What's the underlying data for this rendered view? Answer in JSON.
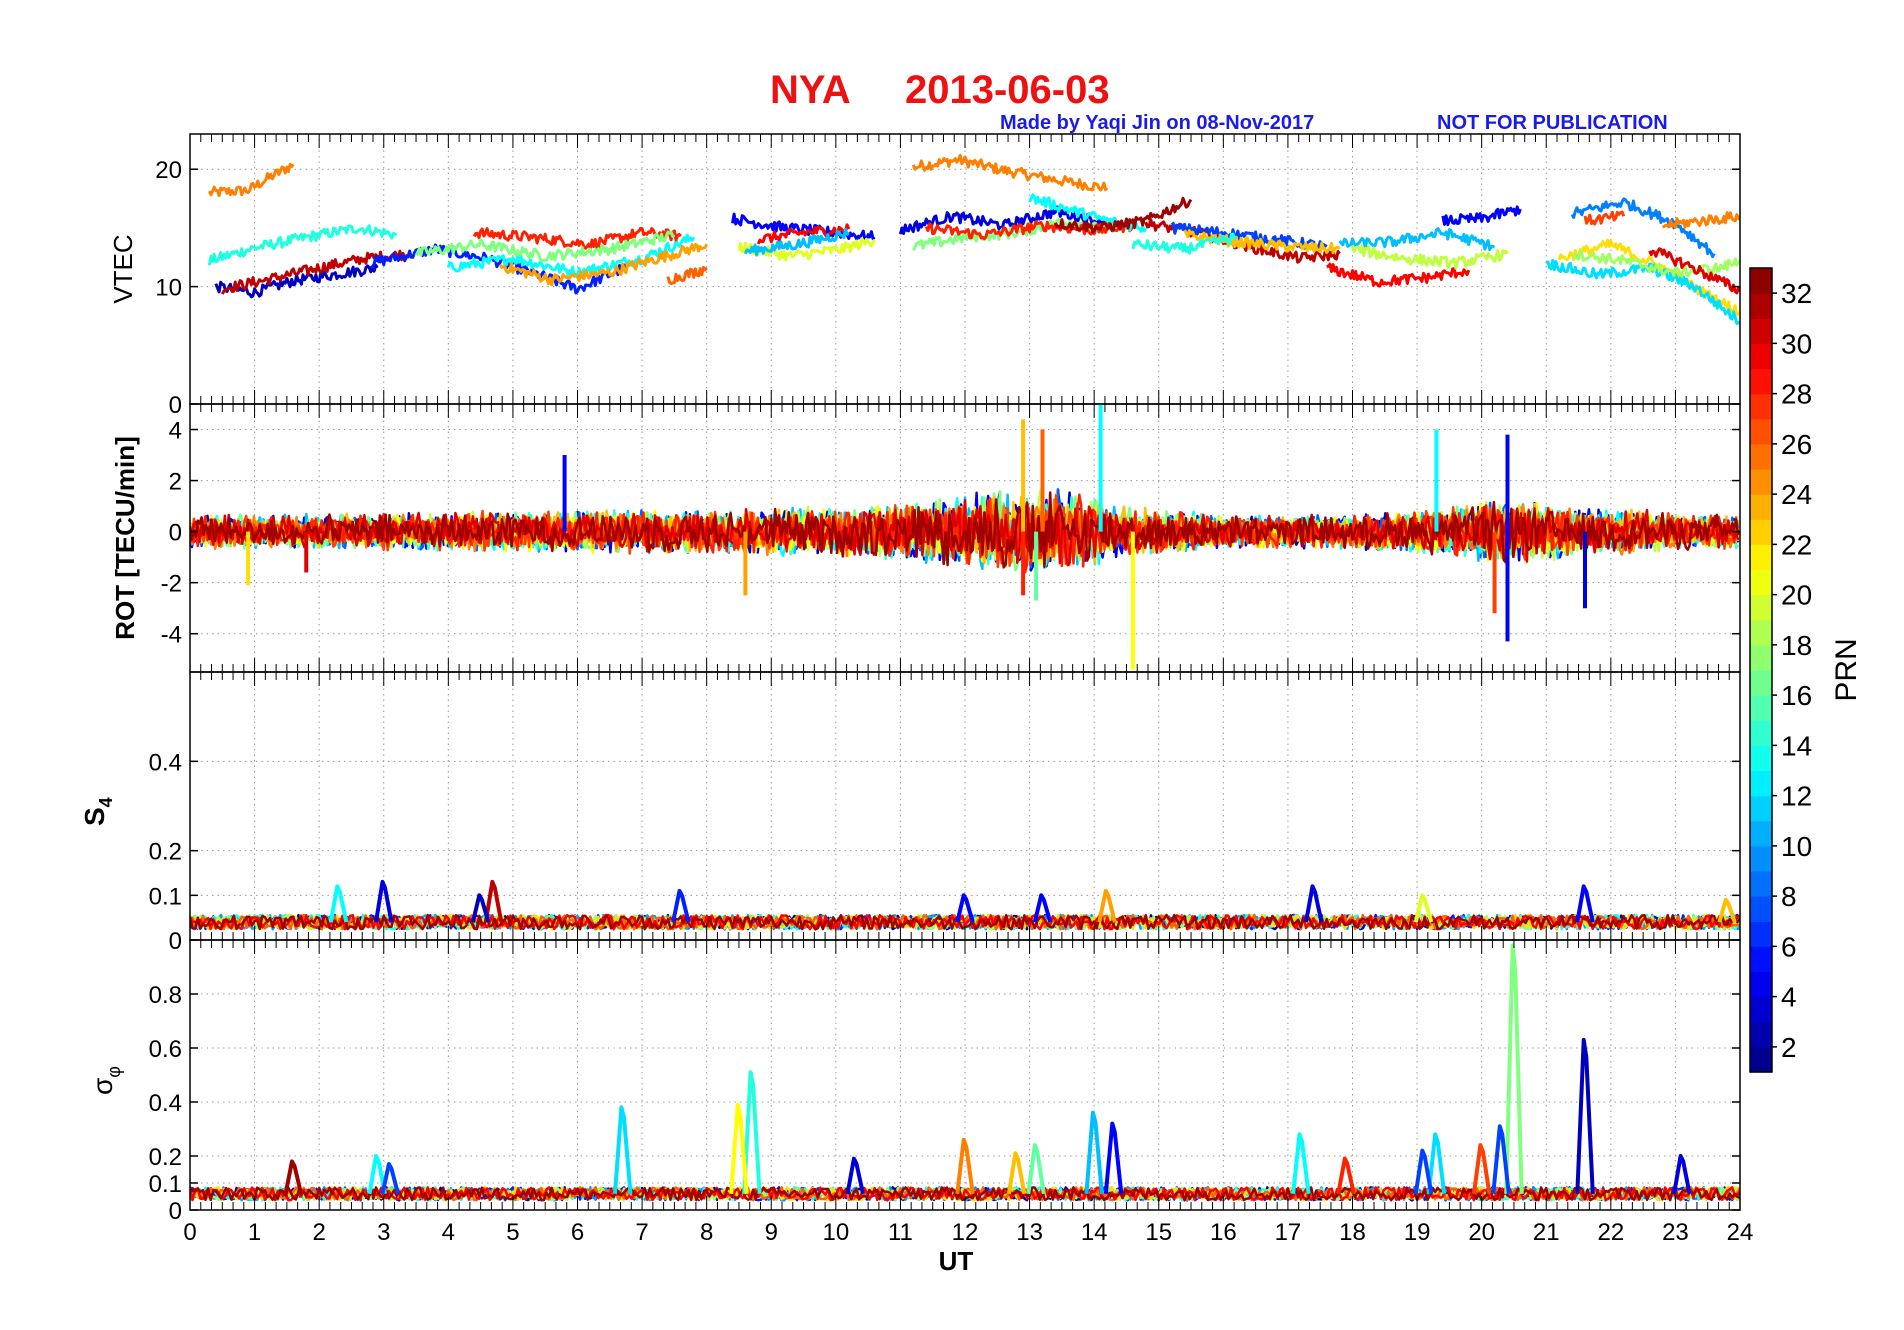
{
  "figure": {
    "station": "NYA",
    "date": "2013-06-03",
    "credit": "Made by Yaqi Jin on 08-Nov-2017",
    "notice": "NOT FOR PUBLICATION"
  },
  "chart_data": [
    {
      "type": "line",
      "panel": "vtec",
      "ylabel": "VTEC",
      "ylim": [
        0,
        23
      ],
      "yticks": [
        "0",
        "10",
        "20"
      ],
      "grid": true,
      "series": [
        {
          "prn": 25,
          "x": [
            0.3,
            0.9,
            1.2,
            1.6
          ],
          "y": [
            18.0,
            18.2,
            19.2,
            20.4
          ]
        },
        {
          "prn": 25,
          "x": [
            11.2,
            11.9,
            12.6,
            13.5,
            14.2
          ],
          "y": [
            20.2,
            20.8,
            19.9,
            19.0,
            18.4
          ]
        },
        {
          "prn": 14,
          "x": [
            0.3,
            1.0,
            1.8,
            2.6,
            3.2
          ],
          "y": [
            12.2,
            13.3,
            14.2,
            15.0,
            14.4
          ]
        },
        {
          "prn": 3,
          "x": [
            0.4,
            1.0,
            1.6,
            2.2,
            2.9
          ],
          "y": [
            10.0,
            9.5,
            10.5,
            11.0,
            11.6
          ]
        },
        {
          "prn": 31,
          "x": [
            0.5,
            1.2,
            2.0,
            2.7,
            3.4
          ],
          "y": [
            9.8,
            10.6,
            11.6,
            12.4,
            12.8
          ]
        },
        {
          "prn": 6,
          "x": [
            2.8,
            3.8,
            4.6,
            5.4,
            6.0,
            6.8
          ],
          "y": [
            12.0,
            13.2,
            12.4,
            11.0,
            9.8,
            11.8
          ]
        },
        {
          "prn": 13,
          "x": [
            4.0,
            5.0,
            6.0,
            7.0,
            7.8
          ],
          "y": [
            11.6,
            12.4,
            11.2,
            12.4,
            14.2
          ]
        },
        {
          "prn": 28,
          "x": [
            4.4,
            5.3,
            6.2,
            7.0,
            7.6
          ],
          "y": [
            14.6,
            14.2,
            13.6,
            14.6,
            14.3
          ]
        },
        {
          "prn": 24,
          "x": [
            4.8,
            5.6,
            6.5,
            7.3,
            8.0
          ],
          "y": [
            11.8,
            10.6,
            11.2,
            12.5,
            13.6
          ]
        },
        {
          "prn": 17,
          "x": [
            3.5,
            4.5,
            5.5,
            6.5,
            7.5
          ],
          "y": [
            12.8,
            13.6,
            12.6,
            13.2,
            14.4
          ]
        },
        {
          "prn": 26,
          "x": [
            7.4,
            7.8,
            8.0
          ],
          "y": [
            10.6,
            11.2,
            11.6
          ]
        },
        {
          "prn": 5,
          "x": [
            8.4,
            9.2,
            10.0,
            10.6
          ],
          "y": [
            15.8,
            15.0,
            14.6,
            14.2
          ]
        },
        {
          "prn": 20,
          "x": [
            8.5,
            9.3,
            10.1,
            10.6
          ],
          "y": [
            13.4,
            12.6,
            13.2,
            14.0
          ]
        },
        {
          "prn": 29,
          "x": [
            8.8,
            9.5,
            10.2
          ],
          "y": [
            14.0,
            14.6,
            14.9
          ]
        },
        {
          "prn": 11,
          "x": [
            8.6,
            9.4,
            10.2
          ],
          "y": [
            13.0,
            13.6,
            14.6
          ]
        },
        {
          "prn": 4,
          "x": [
            11.0,
            11.8,
            12.6,
            13.4,
            14.2
          ],
          "y": [
            14.8,
            16.0,
            15.2,
            16.4,
            15.4
          ]
        },
        {
          "prn": 17,
          "x": [
            11.2,
            12.0,
            12.8,
            13.6,
            14.3
          ],
          "y": [
            13.4,
            14.2,
            14.6,
            15.6,
            14.6
          ]
        },
        {
          "prn": 28,
          "x": [
            11.4,
            12.3,
            13.2,
            14.0,
            14.6
          ],
          "y": [
            15.0,
            14.4,
            15.2,
            14.8,
            15.2
          ]
        },
        {
          "prn": 13,
          "x": [
            13.0,
            13.6,
            14.2,
            14.8
          ],
          "y": [
            17.6,
            16.6,
            15.6,
            15.0
          ]
        },
        {
          "prn": 32,
          "x": [
            13.4,
            14.1,
            14.8,
            15.5
          ],
          "y": [
            15.4,
            15.0,
            15.6,
            17.4
          ]
        },
        {
          "prn": 31,
          "x": [
            14.8,
            15.6,
            16.4,
            17.2,
            17.8
          ],
          "y": [
            15.4,
            14.6,
            13.4,
            12.4,
            12.8
          ]
        },
        {
          "prn": 7,
          "x": [
            15.2,
            16.0,
            16.8,
            17.6
          ],
          "y": [
            15.0,
            14.6,
            14.0,
            13.4
          ]
        },
        {
          "prn": 23,
          "x": [
            15.4,
            16.2,
            17.0,
            17.8
          ],
          "y": [
            14.4,
            13.8,
            13.4,
            13.2
          ]
        },
        {
          "prn": 14,
          "x": [
            14.6,
            15.4,
            16.2
          ],
          "y": [
            13.6,
            13.2,
            14.2
          ]
        },
        {
          "prn": 29,
          "x": [
            17.6,
            18.4,
            19.2,
            19.8
          ],
          "y": [
            11.6,
            10.4,
            10.8,
            11.4
          ]
        },
        {
          "prn": 11,
          "x": [
            17.8,
            18.6,
            19.4,
            20.2
          ],
          "y": [
            13.6,
            13.8,
            14.6,
            13.4
          ]
        },
        {
          "prn": 19,
          "x": [
            18.0,
            18.8,
            19.6,
            20.4
          ],
          "y": [
            13.2,
            12.4,
            12.0,
            12.8
          ]
        },
        {
          "prn": 5,
          "x": [
            19.4,
            20.0,
            20.6
          ],
          "y": [
            15.6,
            15.8,
            16.6
          ]
        },
        {
          "prn": 9,
          "x": [
            21.4,
            22.2,
            23.0,
            23.6
          ],
          "y": [
            16.2,
            17.2,
            15.4,
            12.8
          ]
        },
        {
          "prn": 27,
          "x": [
            21.6,
            22.2
          ],
          "y": [
            15.6,
            16.0
          ]
        },
        {
          "prn": 25,
          "x": [
            22.8,
            23.4,
            24.0
          ],
          "y": [
            15.2,
            15.6,
            16.0
          ]
        },
        {
          "prn": 22,
          "x": [
            21.2,
            22.0,
            22.8,
            23.4,
            24.0
          ],
          "y": [
            12.4,
            13.6,
            11.6,
            9.6,
            7.8
          ]
        },
        {
          "prn": 12,
          "x": [
            21.0,
            21.8,
            22.6,
            23.3,
            24.0
          ],
          "y": [
            12.0,
            11.0,
            11.6,
            10.0,
            7.0
          ]
        },
        {
          "prn": 18,
          "x": [
            21.4,
            22.2,
            23.0,
            23.7,
            24.0
          ],
          "y": [
            12.8,
            12.2,
            11.2,
            11.6,
            12.2
          ]
        },
        {
          "prn": 30,
          "x": [
            22.6,
            23.2,
            23.8,
            24.0
          ],
          "y": [
            13.2,
            11.8,
            10.2,
            9.6
          ]
        }
      ]
    },
    {
      "type": "line",
      "panel": "rot",
      "ylabel": "ROT [TECU/min]",
      "ylim": [
        -5.5,
        5
      ],
      "yticks": [
        "-4",
        "-2",
        "0",
        "2",
        "4"
      ],
      "grid": true,
      "spikes": [
        {
          "prn": 5,
          "x": 5.8,
          "y": 3.0
        },
        {
          "prn": 5,
          "x": 20.4,
          "y": 3.8
        },
        {
          "prn": 5,
          "x": 20.4,
          "y": -4.3
        },
        {
          "prn": 13,
          "x": 14.1,
          "y": 5.0
        },
        {
          "prn": 23,
          "x": 12.9,
          "y": 4.4
        },
        {
          "prn": 26,
          "x": 13.2,
          "y": 4.0
        },
        {
          "prn": 21,
          "x": 14.6,
          "y": -5.4
        },
        {
          "prn": 4,
          "x": 21.6,
          "y": -3.0
        },
        {
          "prn": 13,
          "x": 19.3,
          "y": 4.0
        },
        {
          "prn": 28,
          "x": 12.9,
          "y": -2.5
        },
        {
          "prn": 24,
          "x": 8.6,
          "y": -2.5
        },
        {
          "prn": 27,
          "x": 20.2,
          "y": -3.2
        },
        {
          "prn": 16,
          "x": 13.1,
          "y": -2.7
        },
        {
          "prn": 22,
          "x": 0.9,
          "y": -2.1
        },
        {
          "prn": 30,
          "x": 1.8,
          "y": -1.6
        }
      ],
      "noise_envelope": {
        "x": [
          0,
          2,
          4,
          6,
          8,
          10,
          11.5,
          12.5,
          13.5,
          14.5,
          16,
          18,
          19.5,
          20.5,
          21.5,
          23,
          24
        ],
        "amplitude": [
          0.7,
          0.7,
          0.8,
          0.9,
          0.9,
          1.0,
          1.3,
          1.8,
          1.7,
          1.0,
          0.7,
          0.7,
          1.0,
          1.4,
          1.0,
          0.8,
          0.7
        ]
      }
    },
    {
      "type": "line",
      "panel": "s4",
      "ylabel": "S4",
      "ylim": [
        0,
        0.6
      ],
      "yticks": [
        "0",
        "0.1",
        "0.2",
        "0.4"
      ],
      "grid": true,
      "baseline": 0.04,
      "peaks": [
        {
          "prn": 4,
          "x": 3.0,
          "y": 0.13
        },
        {
          "prn": 31,
          "x": 4.7,
          "y": 0.13
        },
        {
          "prn": 3,
          "x": 4.5,
          "y": 0.1
        },
        {
          "prn": 6,
          "x": 7.6,
          "y": 0.11
        },
        {
          "prn": 5,
          "x": 12.0,
          "y": 0.1
        },
        {
          "prn": 5,
          "x": 13.2,
          "y": 0.1
        },
        {
          "prn": 24,
          "x": 14.2,
          "y": 0.11
        },
        {
          "prn": 4,
          "x": 17.4,
          "y": 0.12
        },
        {
          "prn": 20,
          "x": 19.1,
          "y": 0.1
        },
        {
          "prn": 5,
          "x": 21.6,
          "y": 0.12
        },
        {
          "prn": 13,
          "x": 2.3,
          "y": 0.12
        },
        {
          "prn": 23,
          "x": 23.8,
          "y": 0.09
        }
      ]
    },
    {
      "type": "line",
      "panel": "sigma_phi",
      "ylabel": "σφ",
      "ylim": [
        0,
        1
      ],
      "yticks": [
        "0",
        "0.1",
        "0.2",
        "0.4",
        "0.6",
        "0.8"
      ],
      "grid": true,
      "baseline": 0.06,
      "peaks": [
        {
          "prn": 17,
          "x": 20.5,
          "y": 0.98
        },
        {
          "prn": 3,
          "x": 21.6,
          "y": 0.63
        },
        {
          "prn": 14,
          "x": 8.7,
          "y": 0.51
        },
        {
          "prn": 12,
          "x": 6.7,
          "y": 0.38
        },
        {
          "prn": 21,
          "x": 8.5,
          "y": 0.39
        },
        {
          "prn": 11,
          "x": 14.0,
          "y": 0.36
        },
        {
          "prn": 5,
          "x": 14.3,
          "y": 0.32
        },
        {
          "prn": 7,
          "x": 20.3,
          "y": 0.31
        },
        {
          "prn": 13,
          "x": 17.2,
          "y": 0.28
        },
        {
          "prn": 12,
          "x": 19.3,
          "y": 0.28
        },
        {
          "prn": 25,
          "x": 12.0,
          "y": 0.26
        },
        {
          "prn": 27,
          "x": 20.0,
          "y": 0.24
        },
        {
          "prn": 7,
          "x": 19.1,
          "y": 0.22
        },
        {
          "prn": 16,
          "x": 13.1,
          "y": 0.24
        },
        {
          "prn": 4,
          "x": 23.1,
          "y": 0.2
        },
        {
          "prn": 28,
          "x": 17.9,
          "y": 0.19
        },
        {
          "prn": 4,
          "x": 10.3,
          "y": 0.19
        },
        {
          "prn": 32,
          "x": 1.6,
          "y": 0.18
        },
        {
          "prn": 13,
          "x": 2.9,
          "y": 0.2
        },
        {
          "prn": 7,
          "x": 3.1,
          "y": 0.17
        },
        {
          "prn": 23,
          "x": 12.8,
          "y": 0.21
        }
      ]
    }
  ],
  "x_axis": {
    "label": "UT",
    "ticks": [
      "0",
      "1",
      "2",
      "3",
      "4",
      "5",
      "6",
      "7",
      "8",
      "9",
      "10",
      "11",
      "12",
      "13",
      "14",
      "15",
      "16",
      "17",
      "18",
      "19",
      "20",
      "21",
      "22",
      "23",
      "24"
    ]
  },
  "colorbar": {
    "label": "PRN",
    "range": [
      1,
      33
    ],
    "ticks": [
      "2",
      "4",
      "6",
      "8",
      "10",
      "12",
      "14",
      "16",
      "18",
      "20",
      "22",
      "24",
      "26",
      "28",
      "30",
      "32"
    ],
    "colormap": "jet"
  },
  "colors": {
    "title": "#ee1111",
    "credit": "#1a1aee"
  }
}
